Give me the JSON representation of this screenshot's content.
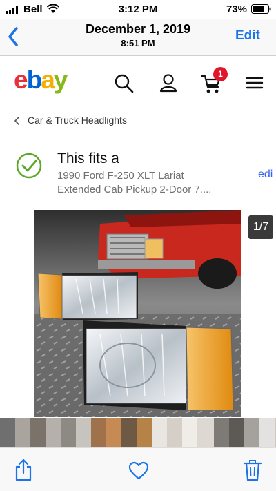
{
  "status_bar": {
    "carrier": "Bell",
    "time": "3:12 PM",
    "battery_percent": "73%"
  },
  "photos_header": {
    "date": "December 1, 2019",
    "time": "8:51 PM",
    "edit_label": "Edit"
  },
  "ebay": {
    "logo_letters": [
      "e",
      "b",
      "a",
      "y"
    ],
    "logo_colors": [
      "#e53238",
      "#0064d2",
      "#f5af02",
      "#86b817"
    ],
    "cart_count": "1",
    "breadcrumb": "Car & Truck Headlights",
    "fits": {
      "title": "This fits a",
      "vehicle_line1": "1990 Ford F-250 XLT Lariat",
      "vehicle_line2": "Extended Cab Pickup 2-Door 7....",
      "edit_label": "edi"
    },
    "image_counter": "1/7"
  },
  "accent_colors": {
    "ios_blue": "#1a73e8",
    "ebay_link": "#3665f3",
    "check_green": "#5ba829",
    "badge_red": "#e0162b"
  },
  "icons": [
    "back-chevron-icon",
    "search-icon",
    "user-icon",
    "cart-icon",
    "menu-icon",
    "breadcrumb-chevron-icon",
    "check-circle-icon",
    "share-icon",
    "heart-icon",
    "trash-icon"
  ]
}
